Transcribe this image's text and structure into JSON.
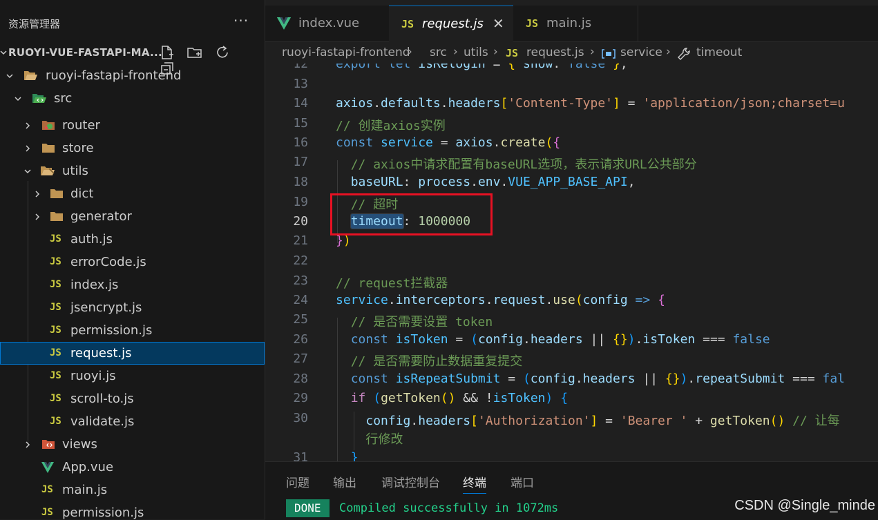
{
  "explorer": {
    "title": "资源管理器",
    "more": "···",
    "project": "RUOYI-VUE-FASTAPI-MA...",
    "tree": [
      {
        "label": "ruoyi-fastapi-frontend",
        "kind": "folder-open"
      },
      {
        "label": "src",
        "kind": "folder-open"
      },
      {
        "label": "router",
        "kind": "folder"
      },
      {
        "label": "store",
        "kind": "folder"
      },
      {
        "label": "utils",
        "kind": "folder-open"
      },
      {
        "label": "dict",
        "kind": "folder"
      },
      {
        "label": "generator",
        "kind": "folder"
      },
      {
        "label": "auth.js",
        "kind": "js"
      },
      {
        "label": "errorCode.js",
        "kind": "js"
      },
      {
        "label": "index.js",
        "kind": "js"
      },
      {
        "label": "jsencrypt.js",
        "kind": "js"
      },
      {
        "label": "permission.js",
        "kind": "js"
      },
      {
        "label": "request.js",
        "kind": "js",
        "selected": true
      },
      {
        "label": "ruoyi.js",
        "kind": "js"
      },
      {
        "label": "scroll-to.js",
        "kind": "js"
      },
      {
        "label": "validate.js",
        "kind": "js"
      },
      {
        "label": "views",
        "kind": "folder"
      },
      {
        "label": "App.vue",
        "kind": "vue"
      },
      {
        "label": "main.js",
        "kind": "js"
      },
      {
        "label": "permission.js",
        "kind": "js"
      }
    ]
  },
  "tabs": [
    {
      "label": "index.vue",
      "active": false
    },
    {
      "label": "request.js",
      "active": true
    },
    {
      "label": "main.js",
      "active": false
    }
  ],
  "js_badge": "JS",
  "close_glyph": "✕",
  "breadcrumb": [
    "ruoyi-fastapi-frontend",
    "src",
    "utils",
    "request.js",
    "service",
    "timeout"
  ],
  "editor": {
    "current_line": 20,
    "line_numbers": [
      "12",
      "13",
      "14",
      "15",
      "16",
      "17",
      "18",
      "19",
      "20",
      "21",
      "22",
      "23",
      "24",
      "25",
      "26",
      "27",
      "28",
      "29",
      "30",
      "",
      "31"
    ]
  },
  "panel": {
    "tabs": [
      "问题",
      "输出",
      "调试控制台",
      "终端",
      "端口"
    ],
    "active_tab": "终端",
    "status_badge": "DONE",
    "status_text": "Compiled successfully in 1072ms"
  },
  "watermark": "CSDN @Single_minde",
  "colors": {
    "accent": "#0078d4",
    "highlight_box": "#e81123",
    "done_badge": "#16825d",
    "js_icon": "#cbcb41",
    "vue_icon": "#41b883"
  }
}
